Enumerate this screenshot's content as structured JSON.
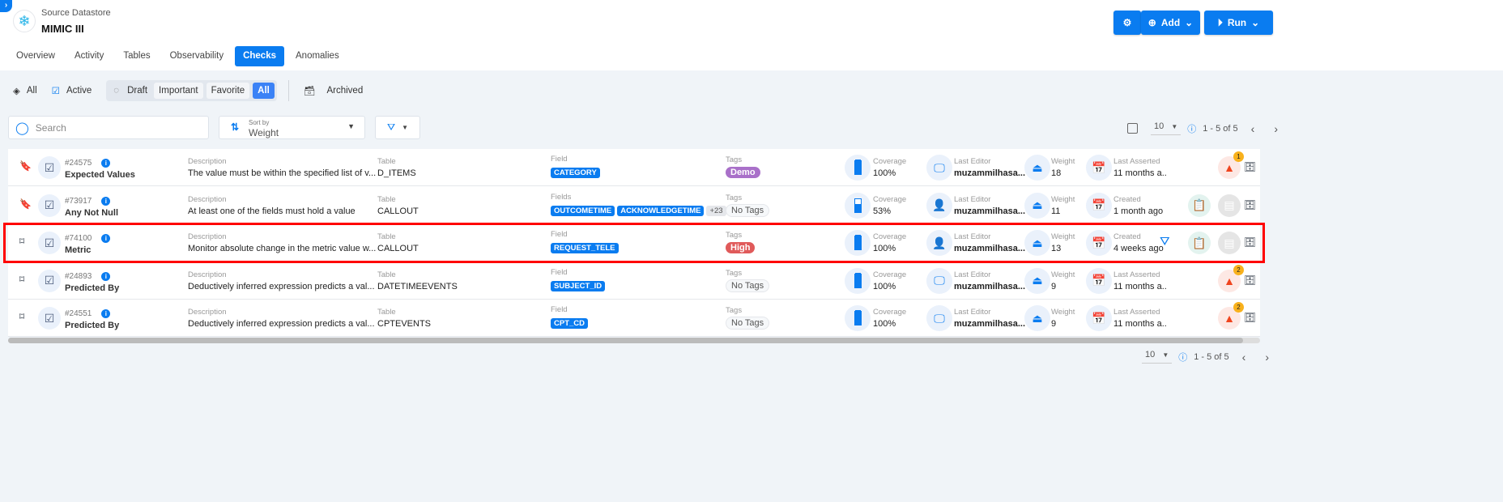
{
  "header": {
    "breadcrumb": "Source Datastore",
    "datastore_name": "MIMIC III",
    "add_label": "Add",
    "run_label": "Run"
  },
  "tabs": [
    {
      "label": "Overview"
    },
    {
      "label": "Activity"
    },
    {
      "label": "Tables"
    },
    {
      "label": "Observability"
    },
    {
      "label": "Checks",
      "active": true
    },
    {
      "label": "Anomalies"
    }
  ],
  "filters": {
    "all": "All",
    "active": "Active",
    "draft": "Draft",
    "important": "Important",
    "favorite": "Favorite",
    "group_all": "All",
    "archived": "Archived"
  },
  "toolbar": {
    "search_placeholder": "Search",
    "sort_label": "Sort by",
    "sort_value": "Weight",
    "page_size": "10",
    "range": "1 - 5 of 5"
  },
  "columns": {
    "description": "Description",
    "table": "Table",
    "tags": "Tags",
    "coverage": "Coverage",
    "last_editor": "Last Editor",
    "weight": "Weight"
  },
  "checks": [
    {
      "id": "#24575",
      "name": "Expected Values",
      "bookmarked": true,
      "description": "The value must be within the specified list of v...",
      "table": "D_ITEMS",
      "field_label": "Field",
      "fields": [
        "CATEGORY"
      ],
      "more": "",
      "tag": "Demo",
      "tag_color": "#a970c9",
      "coverage": "100%",
      "coverage_fraction": 1.0,
      "editor": "muzammilhasa...",
      "editor_icon": "monitor-icon",
      "weight": "18",
      "date_label": "Last Asserted",
      "date": "11 months a..",
      "alerts": "1"
    },
    {
      "id": "#73917",
      "name": "Any Not Null",
      "bookmarked": true,
      "description": "At least one of the fields must hold a value",
      "table": "CALLOUT",
      "field_label": "Fields",
      "fields": [
        "OUTCOMETIME",
        "ACKNOWLEDGETIME"
      ],
      "more": "+23",
      "tag": "No Tags",
      "tag_color": "",
      "coverage": "53%",
      "coverage_fraction": 0.53,
      "editor": "muzammilhasa...",
      "editor_icon": "person-icon",
      "weight": "11",
      "date_label": "Created",
      "date": "1 month ago",
      "alerts": ""
    },
    {
      "id": "#74100",
      "name": "Metric",
      "bookmarked": false,
      "description": "Monitor absolute change in the metric value w...",
      "table": "CALLOUT",
      "field_label": "Field",
      "fields": [
        "REQUEST_TELE"
      ],
      "more": "",
      "tag": "High",
      "tag_color": "#e05a5a",
      "coverage": "100%",
      "coverage_fraction": 1.0,
      "editor": "muzammilhasa...",
      "editor_icon": "person-icon",
      "weight": "13",
      "date_label": "Created",
      "date": "4 weeks ago",
      "alerts": "",
      "highlighted": true
    },
    {
      "id": "#24893",
      "name": "Predicted By",
      "bookmarked": false,
      "description": "Deductively inferred expression predicts a val...",
      "table": "DATETIMEEVENTS",
      "field_label": "Field",
      "fields": [
        "SUBJECT_ID"
      ],
      "more": "",
      "tag": "No Tags",
      "tag_color": "",
      "coverage": "100%",
      "coverage_fraction": 1.0,
      "editor": "muzammilhasa...",
      "editor_icon": "monitor-icon",
      "weight": "9",
      "date_label": "Last Asserted",
      "date": "11 months a..",
      "alerts": "2"
    },
    {
      "id": "#24551",
      "name": "Predicted By",
      "bookmarked": false,
      "description": "Deductively inferred expression predicts a val...",
      "table": "CPTEVENTS",
      "field_label": "Field",
      "fields": [
        "CPT_CD"
      ],
      "more": "",
      "tag": "No Tags",
      "tag_color": "",
      "coverage": "100%",
      "coverage_fraction": 1.0,
      "editor": "muzammilhasa...",
      "editor_icon": "monitor-icon",
      "weight": "9",
      "date_label": "Last Asserted",
      "date": "11 months a..",
      "alerts": "2"
    }
  ],
  "colors": {
    "primary": "#0a7cf0",
    "highlight": "#ff0000"
  }
}
